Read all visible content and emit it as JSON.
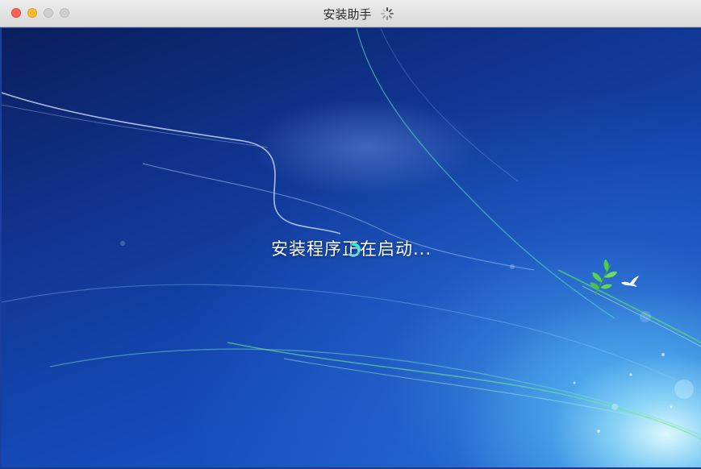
{
  "window": {
    "title": "安装助手",
    "controls": [
      "close",
      "minimize",
      "zoom",
      "fullscreen"
    ]
  },
  "icons": {
    "spinner": "loading-spinner-icon",
    "cursor": "busy-cursor-icon",
    "bird": "dove-icon",
    "leaves": "leaf-branch-icon"
  },
  "desktop": {
    "status_text": "安装程序正在启动..."
  },
  "colors": {
    "close": "#fc5f57",
    "minimize": "#fdbc2e",
    "inactive": "#cfcfcf",
    "background_dark": "#0b1e5c",
    "background_light": "#1a5fcf",
    "glow": "#a0ebff",
    "leaf": "#5ccf52"
  }
}
